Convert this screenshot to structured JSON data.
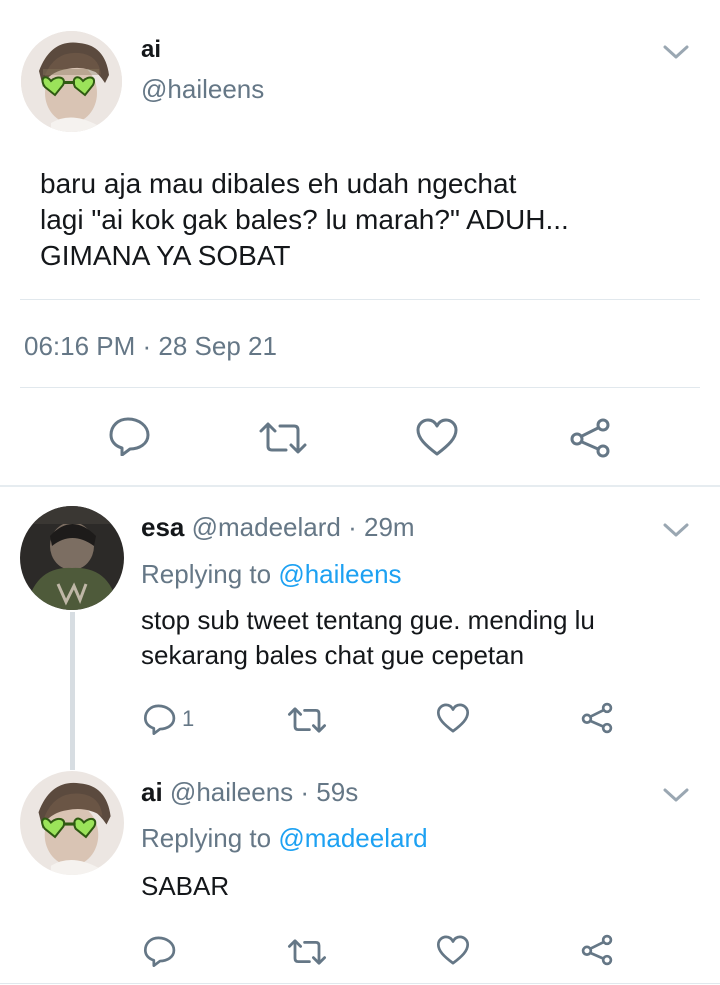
{
  "main_tweet": {
    "display_name": "ai",
    "handle": "@haileens",
    "text_lines": [
      "baru aja mau dibales eh udah ngechat",
      "lagi \"ai kok gak bales? lu marah?\" ADUH...",
      "GIMANA YA SOBAT"
    ],
    "timestamp": "06:16 PM · 28 Sep 21"
  },
  "replies": [
    {
      "display_name": "esa",
      "handle": "@madeelard",
      "time": "· 29m",
      "replying_prefix": "Replying to",
      "replying_to": "@madeelard_target",
      "replying_to_text": "@haileens",
      "text_lines": [
        "stop sub tweet tentang gue. mending lu",
        "sekarang bales chat gue cepetan"
      ],
      "reply_count": "1"
    },
    {
      "display_name": "ai",
      "handle": "@haileens",
      "time": "· 59s",
      "replying_prefix": "Replying to",
      "replying_to_text": "@madeelard",
      "text_lines": [
        "SABAR"
      ]
    }
  ],
  "colors": {
    "text": "#14171a",
    "muted": "#657786",
    "link": "#1da1f2",
    "divider": "#e1e8ed"
  },
  "icons": [
    "chevron-down-icon",
    "reply-icon",
    "retweet-icon",
    "like-icon",
    "share-icon"
  ]
}
